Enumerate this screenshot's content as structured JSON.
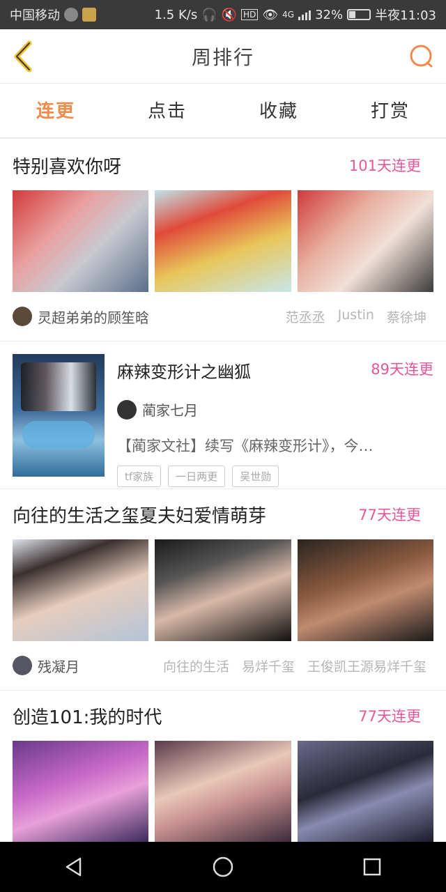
{
  "status": {
    "carrier": "中国移动",
    "speed": "1.5 K/s",
    "net": "4G",
    "battery": "32%",
    "time": "半夜11:03"
  },
  "header": {
    "title": "周排行"
  },
  "tabs": [
    {
      "label": "连更",
      "active": true
    },
    {
      "label": "点击",
      "active": false
    },
    {
      "label": "收藏",
      "active": false
    },
    {
      "label": "打赏",
      "active": false
    }
  ],
  "cards": [
    {
      "title": "特别喜欢你呀",
      "streak": "101天连更",
      "author": "灵超弟弟的顾笙晗",
      "tags": [
        "范丞丞",
        "Justin",
        "蔡徐坤"
      ]
    },
    {
      "title": "麻辣变形计之幽狐",
      "streak": "89天连更",
      "author": "蔺家七月",
      "desc": "【蔺家文社】续写《麻辣变形计》，今…",
      "tags": [
        "tf家族",
        "一日两更",
        "吴世勋"
      ]
    },
    {
      "title": "向往的生活之玺夏夫妇爱情萌芽",
      "streak": "77天连更",
      "author": "残凝月",
      "tags": [
        "向往的生活",
        "易烊千玺",
        "王俊凯王源易烊千玺"
      ]
    },
    {
      "title": "创造101:我的时代",
      "streak": "77天连更"
    }
  ],
  "colors": {
    "accent": "#f08a4b",
    "streak": "#e8559b"
  }
}
